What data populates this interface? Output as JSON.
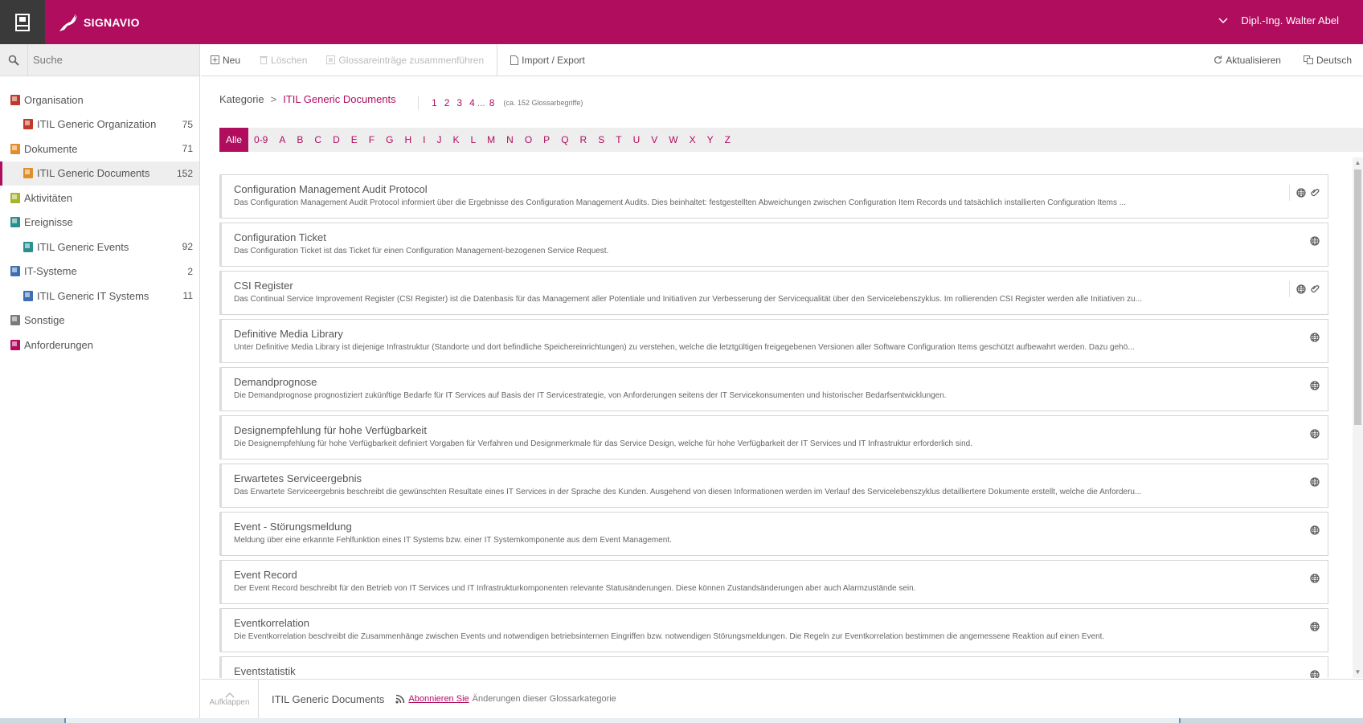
{
  "header": {
    "brand": "SIGNAVIO",
    "user": "Dipl.-Ing. Walter Abel",
    "colors": {
      "brand": "#b10d5f",
      "home_tile": "#3a3a3a"
    }
  },
  "search": {
    "placeholder": "Suche"
  },
  "sidebar": {
    "items": [
      {
        "label": "Organisation",
        "count": "",
        "level": 0,
        "color": "#c0392b"
      },
      {
        "label": "ITIL Generic Organization",
        "count": "75",
        "level": 1,
        "color": "#c0392b"
      },
      {
        "label": "Dokumente",
        "count": "71",
        "level": 0,
        "color": "#e08e2b"
      },
      {
        "label": "ITIL Generic Documents",
        "count": "152",
        "level": 1,
        "color": "#e08e2b",
        "selected": true
      },
      {
        "label": "Aktivitäten",
        "count": "",
        "level": 0,
        "color": "#a6b52a"
      },
      {
        "label": "Ereignisse",
        "count": "",
        "level": 0,
        "color": "#2a8f8f"
      },
      {
        "label": "ITIL Generic Events",
        "count": "92",
        "level": 1,
        "color": "#2a8f8f"
      },
      {
        "label": "IT-Systeme",
        "count": "2",
        "level": 0,
        "color": "#3f6fb3"
      },
      {
        "label": "ITIL Generic IT Systems",
        "count": "11",
        "level": 1,
        "color": "#3f6fb3"
      },
      {
        "label": "Sonstige",
        "count": "",
        "level": 0,
        "color": "#7a7a7a"
      },
      {
        "label": "Anforderungen",
        "count": "",
        "level": 0,
        "color": "#b10d5f"
      }
    ]
  },
  "toolbar": {
    "new_label": "Neu",
    "delete_label": "Löschen",
    "merge_label": "Glossareinträge zusammenführen",
    "import_export_label": "Import / Export",
    "refresh_label": "Aktualisieren",
    "language_label": "Deutsch"
  },
  "breadcrumb": {
    "root": "Kategorie",
    "separator": ">",
    "current": "ITIL Generic Documents"
  },
  "paging": {
    "pages": [
      "1",
      "2",
      "3",
      "4"
    ],
    "ellipsis": "...",
    "last": "8",
    "note": "(ca. 152 Glossarbegriffe)"
  },
  "alphabet": {
    "active": "Alle",
    "letters": [
      "0-9",
      "A",
      "B",
      "C",
      "D",
      "E",
      "F",
      "G",
      "H",
      "I",
      "J",
      "K",
      "L",
      "M",
      "N",
      "O",
      "P",
      "Q",
      "R",
      "S",
      "T",
      "U",
      "V",
      "W",
      "X",
      "Y",
      "Z"
    ]
  },
  "entries": [
    {
      "title": "Configuration Management Audit Protocol",
      "desc": "Das Configuration Management Audit Protocol informiert über die Ergebnisse des Configuration Management Audits. Dies beinhaltet: festgestellten Abweichungen zwischen Configuration Item Records und tatsächlich installierten Configuration Items ...",
      "icons": [
        "globe-icon",
        "paperclip-icon"
      ]
    },
    {
      "title": "Configuration Ticket",
      "desc": "Das Configuration Ticket ist das Ticket für einen Configuration Management-bezogenen Service Request.",
      "icons": [
        "globe-icon"
      ]
    },
    {
      "title": "CSI Register",
      "desc": "Das Continual Service Improvement Register (CSI Register) ist die Datenbasis für das Management aller Potentiale und Initiativen zur Verbesserung der Servicequalität über den Servicelebenszyklus. Im rollierenden CSI Register werden alle Initiativen zu...",
      "icons": [
        "globe-icon",
        "paperclip-icon"
      ]
    },
    {
      "title": "Definitive Media Library",
      "desc": "Unter Definitive Media Library ist diejenige Infrastruktur (Standorte und dort befindliche Speichereinrichtungen) zu verstehen, welche die letztgültigen freigegebenen Versionen aller Software Configuration Items geschützt aufbewahrt werden. Dazu gehö...",
      "icons": [
        "globe-icon"
      ]
    },
    {
      "title": "Demandprognose",
      "desc": "Die Demandprognose prognostiziert zukünftige Bedarfe für IT Services auf Basis der IT Servicestrategie, von Anforderungen seitens der IT Servicekonsumenten und historischer Bedarfsentwicklungen.",
      "icons": [
        "globe-icon"
      ]
    },
    {
      "title": "Designempfehlung für hohe Verfügbarkeit",
      "desc": "Die Designempfehlung für hohe Verfügbarkeit definiert Vorgaben für Verfahren und Designmerkmale für das Service Design, welche für hohe Verfügbarkeit der IT Services und IT Infrastruktur erforderlich sind.",
      "icons": [
        "globe-icon"
      ]
    },
    {
      "title": "Erwartetes Serviceergebnis",
      "desc": "Das Erwartete Serviceergebnis beschreibt die gewünschten Resultate eines IT Services in der Sprache des Kunden. Ausgehend von diesen Informationen werden im Verlauf des Servicelebenszyklus detailliertere Dokumente erstellt, welche die Anforderu...",
      "icons": [
        "globe-icon"
      ]
    },
    {
      "title": "Event - Störungsmeldung",
      "desc": "Meldung über eine erkannte Fehlfunktion eines IT Systems bzw. einer IT Systemkomponente aus dem Event Management.",
      "icons": [
        "globe-icon"
      ]
    },
    {
      "title": "Event Record",
      "desc": "Der Event Record beschreibt für den Betrieb von IT Services und IT Infrastrukturkomponenten relevante Statusänderungen. Diese können Zustandsänderungen aber auch Alarmzustände sein.",
      "icons": [
        "globe-icon"
      ]
    },
    {
      "title": "Eventkorrelation",
      "desc": "Die Eventkorrelation beschreibt die Zusammenhänge zwischen Events und notwendigen betriebsinternen Eingriffen bzw. notwendigen Störungsmeldungen. Die Regeln zur Eventkorrelation bestimmen die angemessene Reaktion auf einen Event.",
      "icons": [
        "globe-icon"
      ]
    },
    {
      "title": "Eventstatistik",
      "desc": "",
      "icons": [
        "globe-icon"
      ]
    }
  ],
  "footer": {
    "expand_label": "Aufklappen",
    "category": "ITIL Generic Documents",
    "subscribe_label": "Abonnieren Sie",
    "note": "Änderungen dieser Glossarkategorie"
  }
}
